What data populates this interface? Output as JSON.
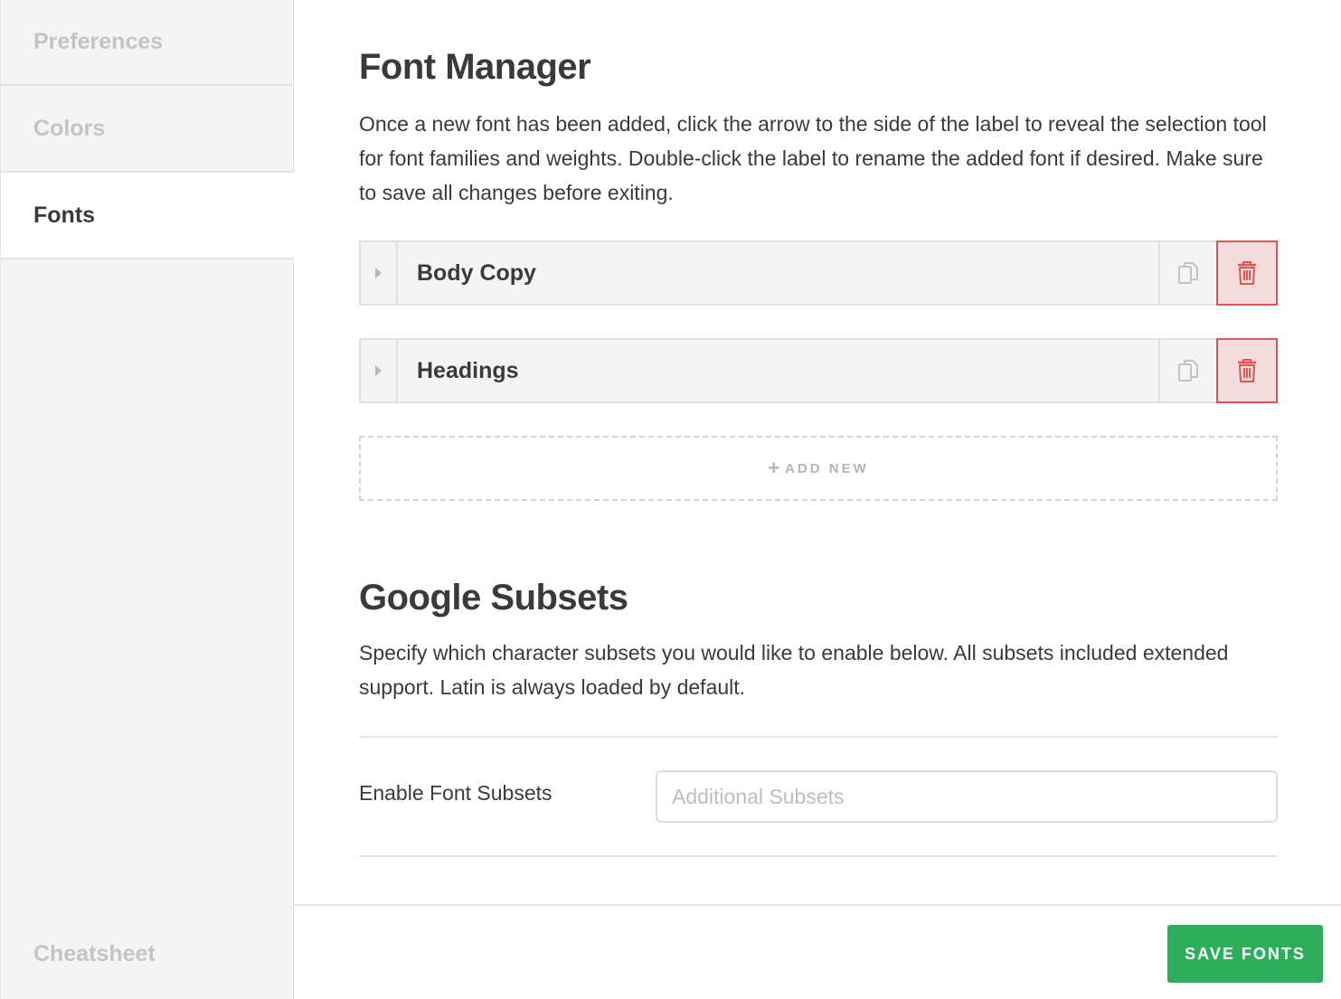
{
  "sidebar": {
    "items": [
      {
        "label": "Preferences"
      },
      {
        "label": "Colors"
      },
      {
        "label": "Fonts"
      }
    ],
    "bottom_item": {
      "label": "Cheatsheet"
    }
  },
  "font_manager": {
    "title": "Font Manager",
    "description": "Once a new font has been added, click the arrow to the side of the label to reveal the selection tool for font families and weights. Double-click the label to rename the added font if desired. Make sure to save all changes before exiting.",
    "fonts": [
      {
        "label": "Body Copy"
      },
      {
        "label": "Headings"
      }
    ],
    "add_new_label": "ADD NEW"
  },
  "google_subsets": {
    "title": "Google Subsets",
    "description": "Specify which character subsets you would like to enable below. All subsets included extended support. Latin is always loaded by default.",
    "field_label": "Enable Font Subsets",
    "input_placeholder": "Additional Subsets",
    "input_value": ""
  },
  "footer": {
    "save_label": "SAVE FONTS"
  },
  "colors": {
    "accent_green": "#2eae5d",
    "delete_red": "#e05454",
    "delete_bg": "#f6dddd"
  }
}
